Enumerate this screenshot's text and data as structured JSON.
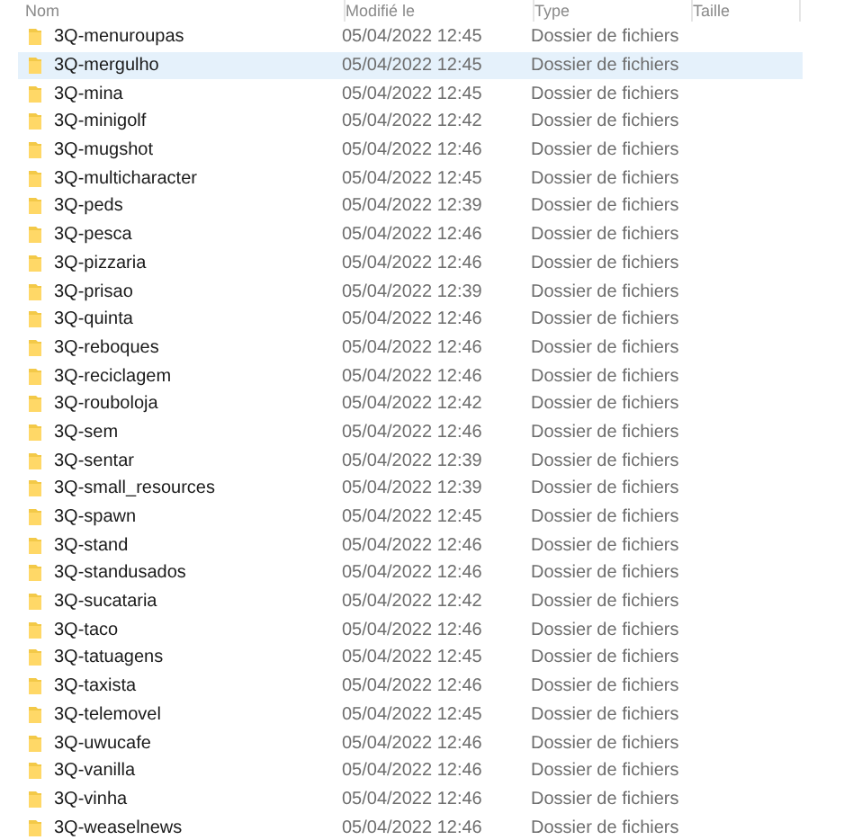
{
  "columns": [
    "Nom",
    "Modifié le",
    "Type",
    "Taille"
  ],
  "rows": [
    {
      "name": "3Q-menuroupas",
      "modified": "05/04/2022 12:45",
      "type": "Dossier de fichiers",
      "selected": false
    },
    {
      "name": "3Q-mergulho",
      "modified": "05/04/2022 12:45",
      "type": "Dossier de fichiers",
      "selected": true
    },
    {
      "name": "3Q-mina",
      "modified": "05/04/2022 12:45",
      "type": "Dossier de fichiers",
      "selected": false
    },
    {
      "name": "3Q-minigolf",
      "modified": "05/04/2022 12:42",
      "type": "Dossier de fichiers",
      "selected": false
    },
    {
      "name": "3Q-mugshot",
      "modified": "05/04/2022 12:46",
      "type": "Dossier de fichiers",
      "selected": false
    },
    {
      "name": "3Q-multicharacter",
      "modified": "05/04/2022 12:45",
      "type": "Dossier de fichiers",
      "selected": false
    },
    {
      "name": "3Q-peds",
      "modified": "05/04/2022 12:39",
      "type": "Dossier de fichiers",
      "selected": false
    },
    {
      "name": "3Q-pesca",
      "modified": "05/04/2022 12:46",
      "type": "Dossier de fichiers",
      "selected": false
    },
    {
      "name": "3Q-pizzaria",
      "modified": "05/04/2022 12:46",
      "type": "Dossier de fichiers",
      "selected": false
    },
    {
      "name": "3Q-prisao",
      "modified": "05/04/2022 12:39",
      "type": "Dossier de fichiers",
      "selected": false
    },
    {
      "name": "3Q-quinta",
      "modified": "05/04/2022 12:46",
      "type": "Dossier de fichiers",
      "selected": false
    },
    {
      "name": "3Q-reboques",
      "modified": "05/04/2022 12:46",
      "type": "Dossier de fichiers",
      "selected": false
    },
    {
      "name": "3Q-reciclagem",
      "modified": "05/04/2022 12:46",
      "type": "Dossier de fichiers",
      "selected": false
    },
    {
      "name": "3Q-rouboloja",
      "modified": "05/04/2022 12:42",
      "type": "Dossier de fichiers",
      "selected": false
    },
    {
      "name": "3Q-sem",
      "modified": "05/04/2022 12:46",
      "type": "Dossier de fichiers",
      "selected": false
    },
    {
      "name": "3Q-sentar",
      "modified": "05/04/2022 12:39",
      "type": "Dossier de fichiers",
      "selected": false
    },
    {
      "name": "3Q-small_resources",
      "modified": "05/04/2022 12:39",
      "type": "Dossier de fichiers",
      "selected": false
    },
    {
      "name": "3Q-spawn",
      "modified": "05/04/2022 12:45",
      "type": "Dossier de fichiers",
      "selected": false
    },
    {
      "name": "3Q-stand",
      "modified": "05/04/2022 12:46",
      "type": "Dossier de fichiers",
      "selected": false
    },
    {
      "name": "3Q-standusados",
      "modified": "05/04/2022 12:46",
      "type": "Dossier de fichiers",
      "selected": false
    },
    {
      "name": "3Q-sucataria",
      "modified": "05/04/2022 12:42",
      "type": "Dossier de fichiers",
      "selected": false
    },
    {
      "name": "3Q-taco",
      "modified": "05/04/2022 12:46",
      "type": "Dossier de fichiers",
      "selected": false
    },
    {
      "name": "3Q-tatuagens",
      "modified": "05/04/2022 12:45",
      "type": "Dossier de fichiers",
      "selected": false
    },
    {
      "name": "3Q-taxista",
      "modified": "05/04/2022 12:46",
      "type": "Dossier de fichiers",
      "selected": false
    },
    {
      "name": "3Q-telemovel",
      "modified": "05/04/2022 12:45",
      "type": "Dossier de fichiers",
      "selected": false
    },
    {
      "name": "3Q-uwucafe",
      "modified": "05/04/2022 12:46",
      "type": "Dossier de fichiers",
      "selected": false
    },
    {
      "name": "3Q-vanilla",
      "modified": "05/04/2022 12:46",
      "type": "Dossier de fichiers",
      "selected": false
    },
    {
      "name": "3Q-vinha",
      "modified": "05/04/2022 12:46",
      "type": "Dossier de fichiers",
      "selected": false
    },
    {
      "name": "3Q-weaselnews",
      "modified": "05/04/2022 12:46",
      "type": "Dossier de fichiers",
      "selected": false
    }
  ]
}
